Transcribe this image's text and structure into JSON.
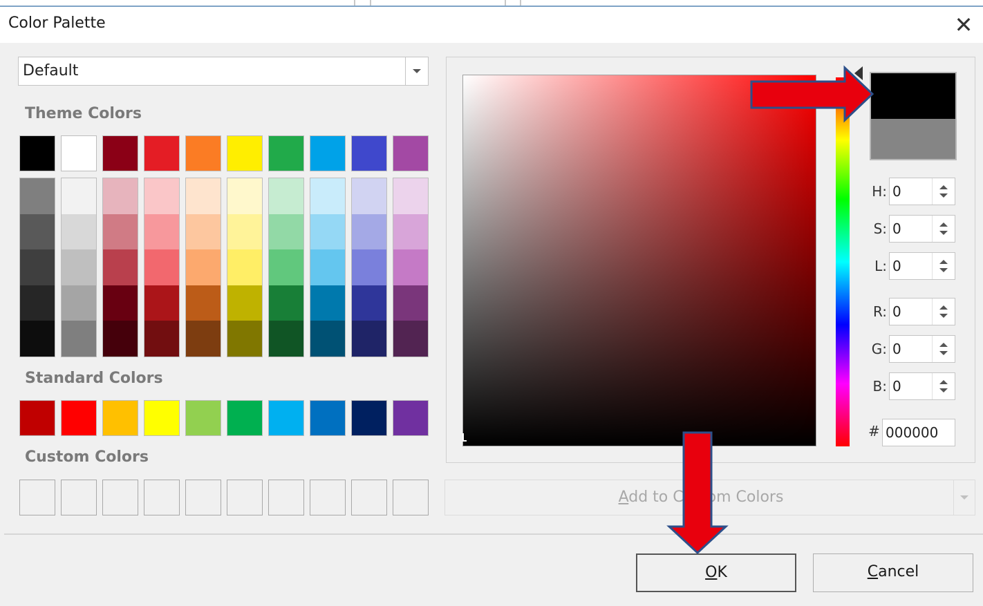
{
  "dialog": {
    "title": "Color Palette",
    "close_label": "✕"
  },
  "palette_select": {
    "value": "Default"
  },
  "sections": {
    "theme": "Theme Colors",
    "standard": "Standard Colors",
    "custom": "Custom Colors"
  },
  "theme_colors": {
    "top_row": [
      "#000000",
      "#ffffff",
      "#8b0016",
      "#e41d25",
      "#fb7c24",
      "#ffee00",
      "#21aa4a",
      "#00a2e8",
      "#3f48cc",
      "#a349a4"
    ],
    "shade_columns": [
      [
        "#7f7f7f",
        "#595959",
        "#3f3f3f",
        "#262626",
        "#0d0d0d"
      ],
      [
        "#f2f2f2",
        "#d8d8d8",
        "#bfbfbf",
        "#a5a5a5",
        "#7f7f7f"
      ],
      [
        "#e7b4bd",
        "#d07b85",
        "#b9404d",
        "#680011",
        "#45000b"
      ],
      [
        "#fac6c8",
        "#f7989c",
        "#f2686e",
        "#ab1519",
        "#720e10"
      ],
      [
        "#fee4ce",
        "#fdc79f",
        "#fca96e",
        "#bc5c18",
        "#7d3d10"
      ],
      [
        "#fff8cc",
        "#fff399",
        "#ffee66",
        "#bfb200",
        "#807700"
      ],
      [
        "#c6ecd1",
        "#92d9a6",
        "#61c87d",
        "#187f37",
        "#105525"
      ],
      [
        "#c9ecfb",
        "#95d8f5",
        "#64c6ef",
        "#0079ad",
        "#005174"
      ],
      [
        "#d1d3f2",
        "#a4a9e6",
        "#7a80dc",
        "#2f369a",
        "#1f2467"
      ],
      [
        "#ecd3ec",
        "#d8a5d9",
        "#c57ac6",
        "#7a367b",
        "#522452"
      ]
    ]
  },
  "standard_colors": [
    "#c00000",
    "#ff0000",
    "#ffc000",
    "#ffff00",
    "#92d050",
    "#00b050",
    "#00b0f0",
    "#0070c0",
    "#002060",
    "#7030a0"
  ],
  "custom_colors": [
    "",
    "",
    "",
    "",
    "",
    "",
    "",
    "",
    "",
    ""
  ],
  "picker": {
    "new_color": "#000000",
    "old_color": "#858585",
    "fields": [
      {
        "label": "H:",
        "value": "0"
      },
      {
        "label": "S:",
        "value": "0"
      },
      {
        "label": "L:",
        "value": "0"
      },
      {
        "label": "R:",
        "value": "0"
      },
      {
        "label": "G:",
        "value": "0"
      },
      {
        "label": "B:",
        "value": "0"
      }
    ],
    "hex_label": "#",
    "hex_value": "000000"
  },
  "add_custom_button": {
    "label": "Add to Custom Colors"
  },
  "buttons": {
    "ok": "OK",
    "cancel": "Cancel"
  },
  "annotation_color": "#e8000d"
}
